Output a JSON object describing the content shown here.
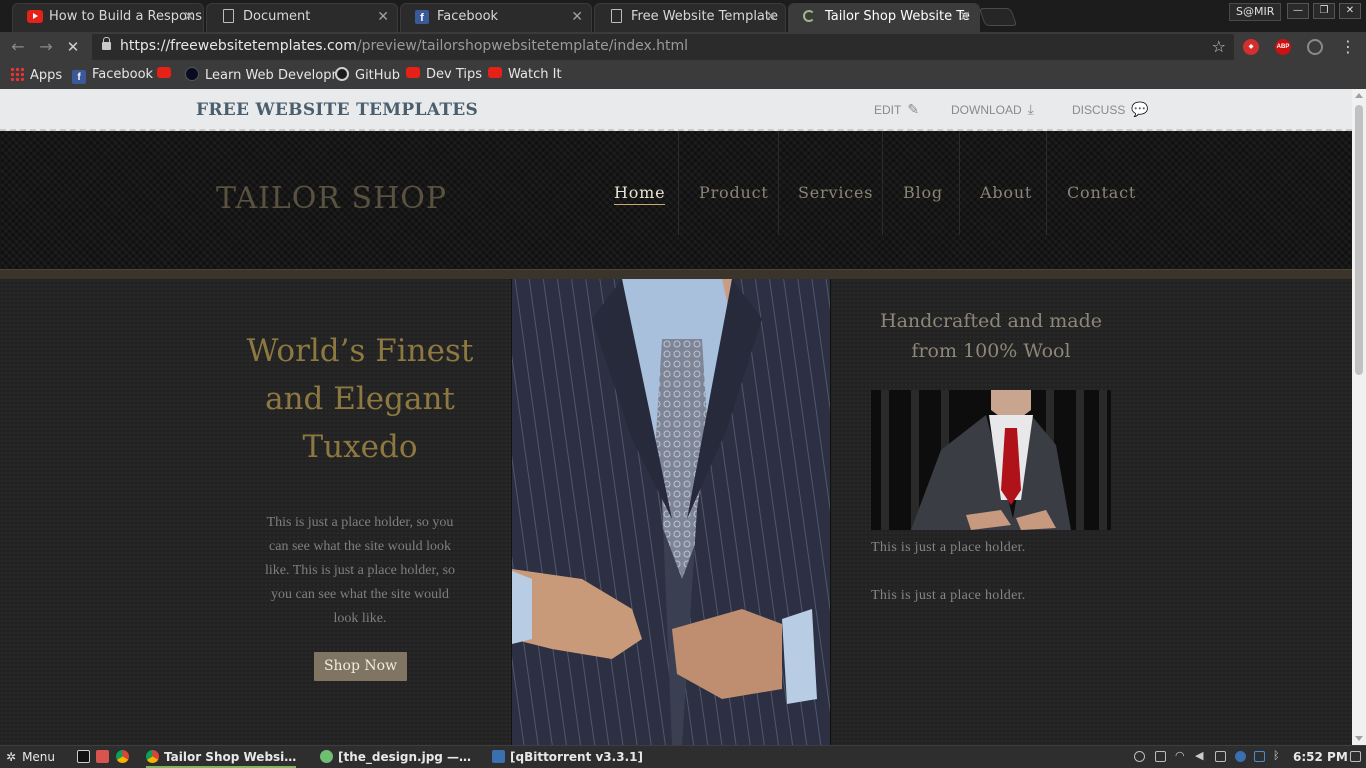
{
  "browser": {
    "tabs": [
      {
        "title": "How to Build a Respons",
        "icon": "youtube-icon"
      },
      {
        "title": "Document",
        "icon": "document-icon"
      },
      {
        "title": "Facebook",
        "icon": "facebook-icon"
      },
      {
        "title": "Free Website Template",
        "icon": "document-icon"
      },
      {
        "title": "Tailor Shop Website Te",
        "icon": "loading-icon",
        "active": true
      }
    ],
    "profile": "S@MIR",
    "url_host": "https://freewebsitetemplates.com",
    "url_path": "/preview/tailorshopwebsitetemplate/index.html",
    "bookmarks": [
      {
        "label": "Apps",
        "icon": "apps-icon"
      },
      {
        "label": "Facebook",
        "icon": "facebook-icon"
      },
      {
        "label": "",
        "icon": "youtube-icon"
      },
      {
        "label": "Learn Web Developm",
        "icon": "freecodecamp-icon"
      },
      {
        "label": "GitHub",
        "icon": "github-icon"
      },
      {
        "label": "Dev Tips",
        "icon": "youtube-icon"
      },
      {
        "label": "Watch It",
        "icon": "youtube-icon"
      }
    ]
  },
  "fwt_bar": {
    "logo": "FREE WEBSITE TEMPLATES",
    "links": [
      {
        "label": "EDIT",
        "icon": "pencil-icon"
      },
      {
        "label": "DOWNLOAD",
        "icon": "download-icon"
      },
      {
        "label": "DISCUSS",
        "icon": "chat-bubbles-icon"
      }
    ]
  },
  "site": {
    "logo": "TAILOR SHOP",
    "nav": [
      "Home",
      "Product",
      "Services",
      "Blog",
      "About",
      "Contact"
    ],
    "active_nav": "Home",
    "hero": {
      "title_lines": [
        "World’s Finest",
        "and Elegant",
        "Tuxedo"
      ],
      "text": "This is just a place holder, so you can see what the site would look like. This is just a place holder, so you can see what the site would look like.",
      "button": "Shop Now"
    },
    "sidebar": {
      "title_lines": [
        "Handcrafted and made",
        "from 100% Wool"
      ],
      "paragraphs": [
        "This is just a place holder.",
        "This is just a place holder."
      ]
    }
  },
  "taskbar": {
    "menu": "Menu",
    "windows": [
      "Tailor Shop Websi…",
      "[the_design.jpg —…",
      "[qBittorrent v3.3.1]"
    ],
    "clock": "6:52 PM"
  },
  "colors": {
    "accent_gold": "#8d7840",
    "button_bg": "#807463",
    "fwt_blue": "#4a5e6e"
  }
}
